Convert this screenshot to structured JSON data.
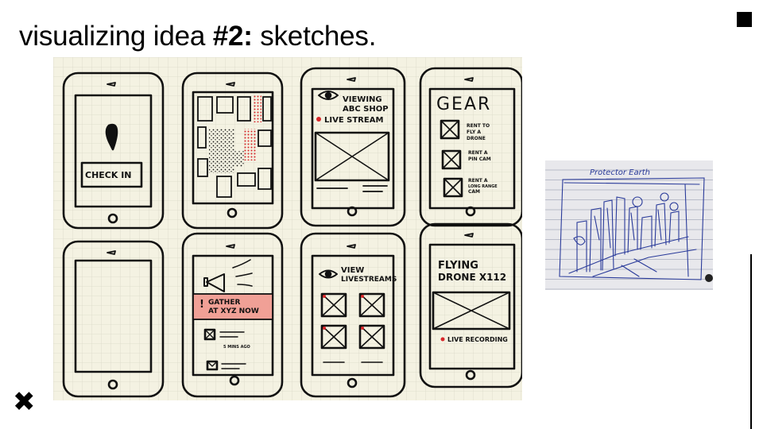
{
  "slide": {
    "title_prefix": "visualizing idea ",
    "title_bold": "#2:",
    "title_suffix": " sketches."
  },
  "icons": {
    "corner": "square-icon",
    "close": "close-icon",
    "close_glyph": "✖"
  },
  "sketches": {
    "checkin_label": "CHECK IN",
    "viewing_line1": "VIEWING",
    "viewing_line2": "ABC SHOP",
    "livestream_label": "LIVE STREAM",
    "gear_title": "GEAR",
    "gear_items": [
      [
        "RENT TO",
        "FLY A",
        "DRONE"
      ],
      [
        "RENT A",
        "PIN CAM"
      ],
      [
        "RENT A",
        "LONG RANGE",
        "CAM"
      ]
    ],
    "gather_line1": "GATHER",
    "gather_line2": "AT XYZ NOW",
    "small_caption": "5 MINS AGO",
    "view_line1": "VIEW",
    "view_line2": "LIVESTREAMS",
    "flying_line1": "FLYING",
    "flying_line2": "DRONE X112",
    "live_recording": "LIVE RECORDING",
    "photo_title": "Protector Earth"
  },
  "colors": {
    "paper": "#f4f2e2",
    "grid_line": "#d8d6c4",
    "ink": "#111111",
    "red": "#d8272a",
    "pink": "#f0a096",
    "pen": "#2a3b9a",
    "notebook": "#e8e8ec"
  }
}
